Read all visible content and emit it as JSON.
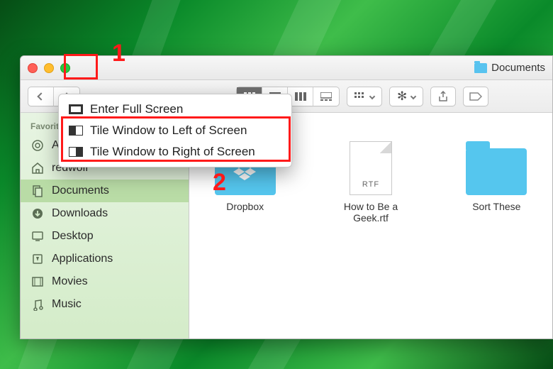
{
  "window": {
    "title": "Documents"
  },
  "annotations": {
    "label1": "1",
    "label2": "2"
  },
  "menu": {
    "items": [
      {
        "label": "Enter Full Screen"
      },
      {
        "label": "Tile Window to Left of Screen"
      },
      {
        "label": "Tile Window to Right of Screen"
      }
    ]
  },
  "sidebar": {
    "section": "Favorites",
    "items": [
      {
        "label": "AirDrop"
      },
      {
        "label": "redwolf"
      },
      {
        "label": "Documents",
        "selected": true
      },
      {
        "label": "Downloads"
      },
      {
        "label": "Desktop"
      },
      {
        "label": "Applications"
      },
      {
        "label": "Movies"
      },
      {
        "label": "Music"
      }
    ]
  },
  "content": {
    "items": [
      {
        "name": "Dropbox",
        "type": "folder-dropbox"
      },
      {
        "name": "How to Be a Geek.rtf",
        "type": "rtf",
        "badge": "RTF"
      },
      {
        "name": "Sort These",
        "type": "folder"
      }
    ]
  }
}
